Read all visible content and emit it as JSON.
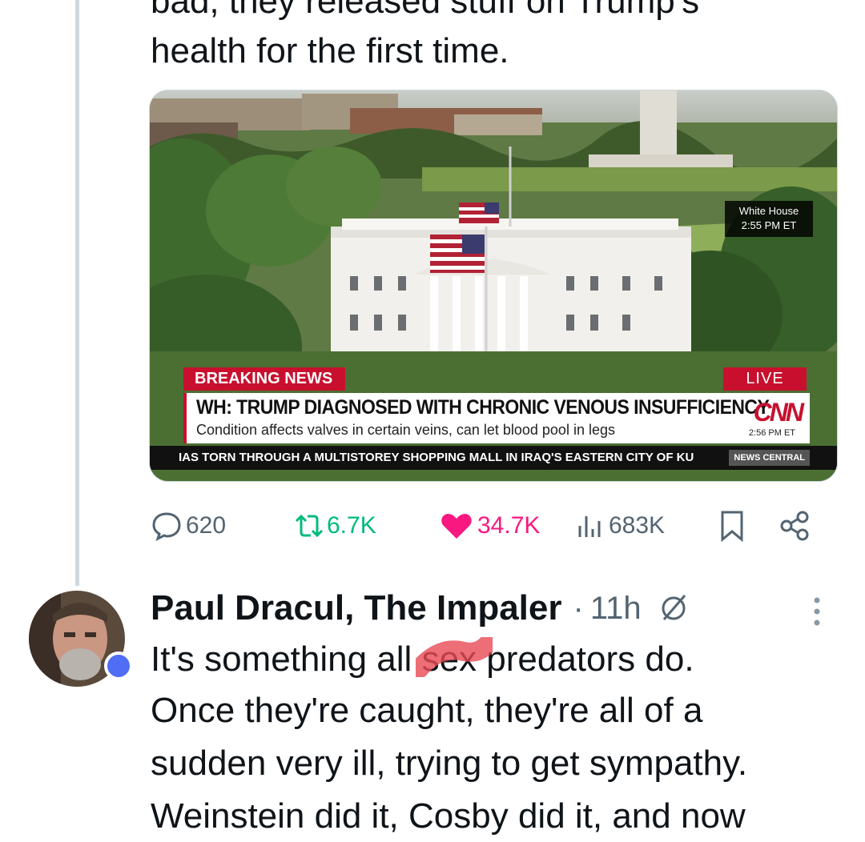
{
  "previous_tweet": {
    "text_line_1": "bad, they released stuff on Trump's",
    "text_line_2": "health for the first time.",
    "media": {
      "location_tag": "White House",
      "location_time": "2:55 PM ET",
      "breaking_label": "BREAKING NEWS",
      "live_label": "LIVE",
      "headline": "WH: TRUMP DIAGNOSED WITH CHRONIC VENOUS INSUFFICIENCY",
      "subheadline": "Condition affects valves in certain veins, can let blood pool in legs",
      "network": "CNN",
      "network_time": "2:56 PM ET",
      "ticker": "IAS TORN THROUGH A MULTISTOREY SHOPPING MALL IN IRAQ'S EASTERN CITY OF KU",
      "ticker_source": "NEWS CENTRAL"
    },
    "actions": {
      "replies": "620",
      "reposts": "6.7K",
      "likes": "34.7K",
      "views": "683K",
      "like_color": "#f91880",
      "repost_color": "#00ba7c",
      "icons": [
        "reply-icon",
        "repost-icon",
        "like-icon",
        "views-icon",
        "bookmark-icon",
        "share-icon"
      ]
    }
  },
  "reply": {
    "display_name": "Paul Dracul, The Impaler",
    "separator": "·",
    "time": "11h",
    "line_1_before": "It's something all ",
    "line_1_redacted": "sex",
    "line_1_after": " predators do.",
    "line_2": "Once they're caught, they're all of a",
    "line_3": "sudden very ill, trying to get sympathy.",
    "line_4": "Weinstein did it, Cosby did it, and now",
    "icons": [
      "avatar",
      "mute-icon",
      "more-icon"
    ]
  }
}
